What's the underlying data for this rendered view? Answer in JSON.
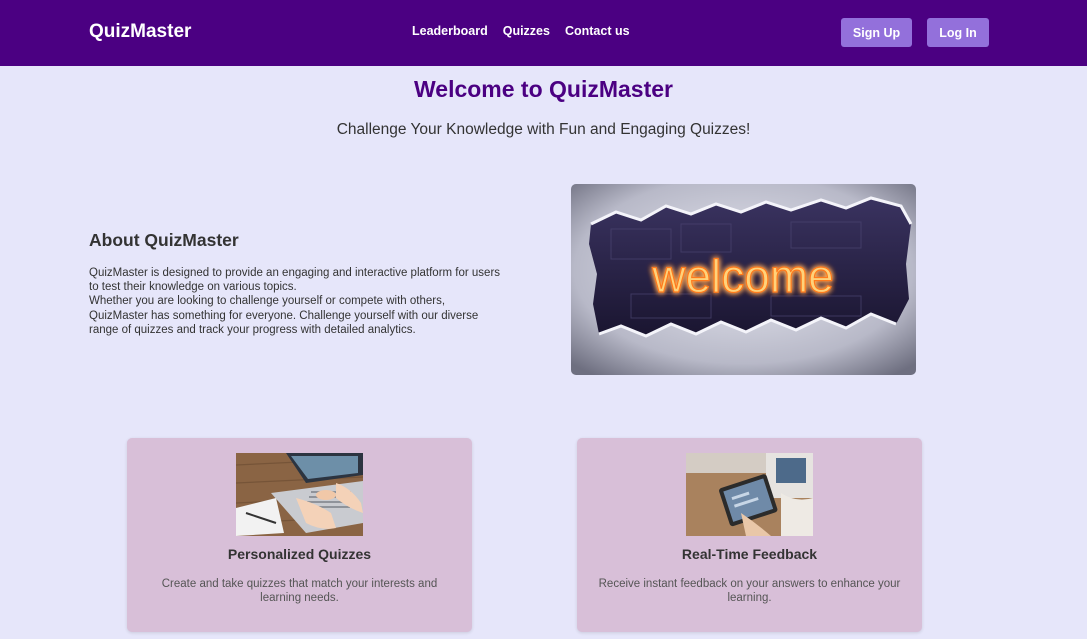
{
  "nav": {
    "brand": "QuizMaster",
    "links": [
      "Leaderboard",
      "Quizzes",
      "Contact us"
    ],
    "signup_label": "Sign Up",
    "login_label": "Log In"
  },
  "hero": {
    "title": "Welcome to QuizMaster",
    "subtitle": "Challenge Your Knowledge with Fun and Engaging Quizzes!"
  },
  "about": {
    "title": "About QuizMaster",
    "lines": [
      "QuizMaster is designed to provide an engaging and interactive platform for users",
      "to test their knowledge on various topics.",
      "Whether you are looking to challenge yourself or compete with others,",
      "QuizMaster has something for everyone. Challenge yourself with our diverse",
      "range of quizzes and track your progress with detailed analytics."
    ],
    "image_text": "welcome"
  },
  "features": [
    {
      "title": "Personalized Quizzes",
      "text": "Create and take quizzes that match your interests and learning needs."
    },
    {
      "title": "Real-Time Feedback",
      "text": "Receive instant feedback on your answers to enhance your learning."
    }
  ],
  "colors": {
    "nav_bg": "#4b0082",
    "button_bg": "#9370db",
    "page_bg": "#e6e6fa",
    "card_bg": "#d8bfd8",
    "title": "#4b0082"
  }
}
